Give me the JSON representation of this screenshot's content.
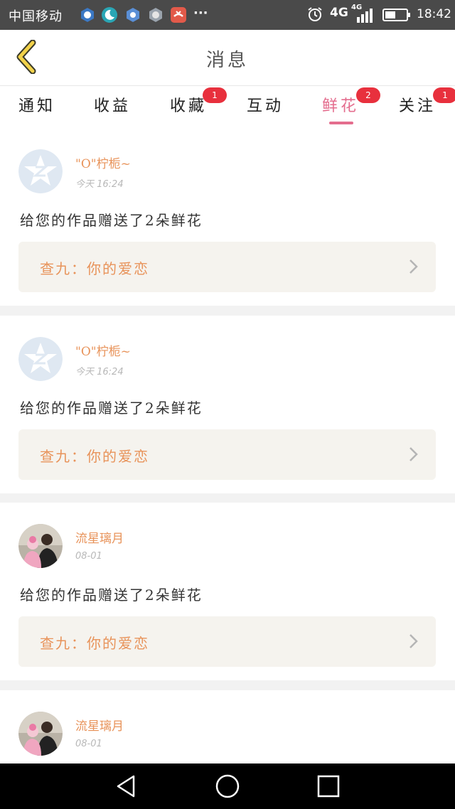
{
  "status_bar": {
    "carrier": "中国移动",
    "more": "···",
    "network": "4G",
    "network_small": "4G",
    "time": "18:42"
  },
  "header": {
    "title": "消息"
  },
  "tabs": [
    {
      "label": "通知",
      "badge": ""
    },
    {
      "label": "收益",
      "badge": ""
    },
    {
      "label": "收藏",
      "badge": "1"
    },
    {
      "label": "互动",
      "badge": ""
    },
    {
      "label": "鲜花",
      "badge": "2",
      "active": true
    },
    {
      "label": "关注",
      "badge": "1"
    }
  ],
  "messages": [
    {
      "username": "\"O\"柠栀~",
      "time": "今天 16:24",
      "text": "给您的作品赠送了2朵鲜花",
      "work": "查九：你的爱恋"
    },
    {
      "username": "\"O\"柠栀~",
      "time": "今天 16:24",
      "text": "给您的作品赠送了2朵鲜花",
      "work": "查九：你的爱恋"
    },
    {
      "username": "流星璃月",
      "time": "08-01",
      "text": "给您的作品赠送了2朵鲜花",
      "work": "查九：你的爱恋"
    },
    {
      "username": "流星璃月",
      "time": "08-01",
      "text": "",
      "work": ""
    }
  ],
  "colors": {
    "accent": "#e46d8e",
    "badge": "#e8303d",
    "username": "#e8935a",
    "status_bar": "#4a4a4a"
  }
}
